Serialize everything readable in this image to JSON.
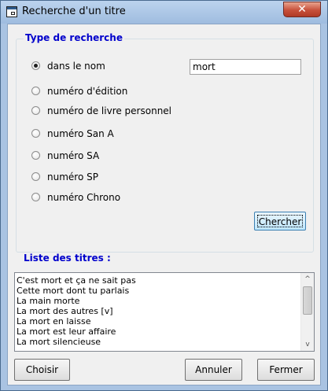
{
  "window": {
    "title": "Recherche d'un titre",
    "close_glyph": "✕",
    "icon": "app-window-icon"
  },
  "search_type": {
    "legend": "Type de recherche",
    "options": [
      {
        "label": "dans le nom",
        "checked": true
      },
      {
        "label": "numéro d'édition",
        "checked": false
      },
      {
        "label": "numéro de livre personnel",
        "checked": false
      },
      {
        "label": "numéro San A",
        "checked": false
      },
      {
        "label": "numéro SA",
        "checked": false
      },
      {
        "label": "numéro SP",
        "checked": false
      },
      {
        "label": "numéro Chrono",
        "checked": false
      }
    ],
    "query_value": "mort",
    "search_button": "Chercher"
  },
  "results": {
    "label": "Liste des titres :",
    "items": [
      "C'est mort et ça ne sait pas",
      "Cette mort dont tu parlais",
      "La main morte",
      "La mort des autres [v]",
      "La mort en laisse",
      "La mort est leur affaire",
      "La mort silencieuse"
    ],
    "scroll_up_glyph": "^",
    "scroll_down_glyph": "v"
  },
  "actions": {
    "choose": "Choisir",
    "cancel": "Annuler",
    "close": "Fermer"
  }
}
